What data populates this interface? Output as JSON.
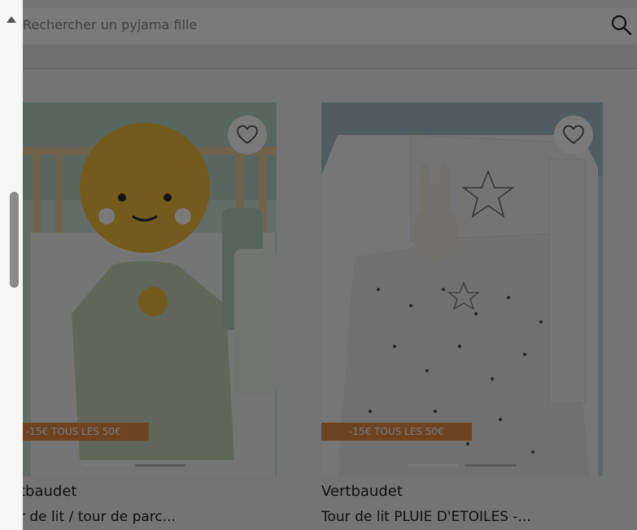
{
  "search": {
    "placeholder": "Rechercher un pyjama fille"
  },
  "products": [
    {
      "brand": "tbaudet",
      "title": "r de lit / tour de parc...",
      "promo": "-15€ TOUS LES 50€"
    },
    {
      "brand": "Vertbaudet",
      "title": "Tour de lit PLUIE D'ETOILES -...",
      "promo": "-15€ TOUS LES 50€"
    }
  ],
  "icons": {
    "search": "search-icon",
    "favorite": "heart-icon",
    "scroll_up": "caret-up-icon"
  },
  "colors": {
    "promo": "#e58c48",
    "overlay": "rgba(0,0,0,0.52)"
  }
}
